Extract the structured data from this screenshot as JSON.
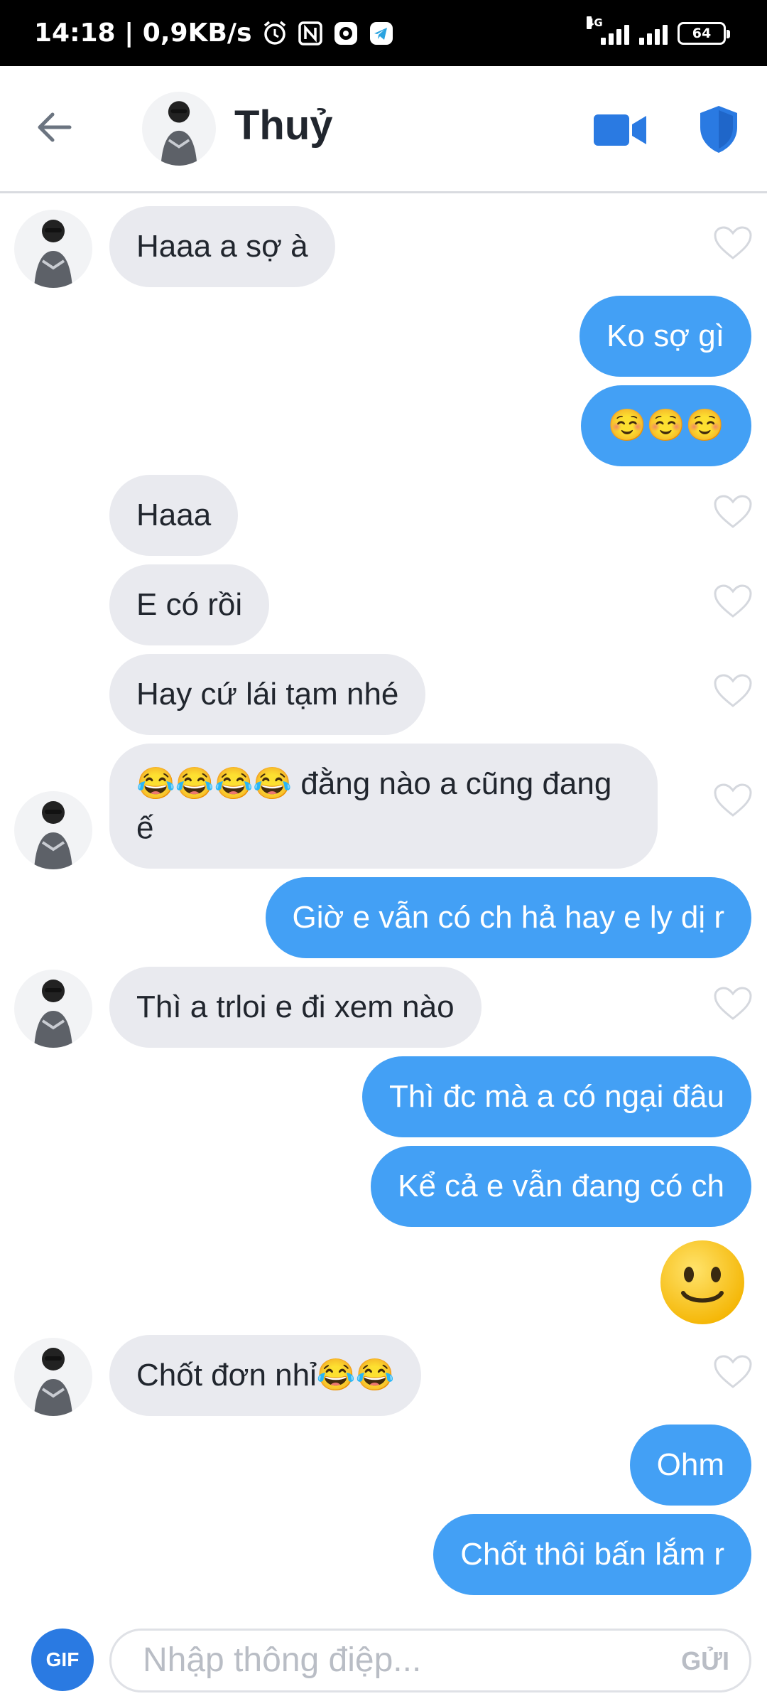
{
  "status_bar": {
    "time_speed": "14:18 | 0,9KB/s",
    "network": "4G",
    "battery": "64"
  },
  "header": {
    "contact_name": "Thuỷ"
  },
  "messages": [
    {
      "dir": "in",
      "text": "Haaa a sợ à"
    },
    {
      "dir": "out",
      "text": "Ko sợ gì"
    },
    {
      "dir": "out",
      "text": "☺️☺️☺️"
    },
    {
      "dir": "in",
      "text": "Haaa"
    },
    {
      "dir": "in",
      "text": "E có rồi"
    },
    {
      "dir": "in",
      "text": "Hay cứ lái tạm nhé"
    },
    {
      "dir": "in",
      "text": "😂😂😂😂 đằng nào a cũng đang ế"
    },
    {
      "dir": "out",
      "text": "Giờ e vẫn có ch hả hay e ly dị r"
    },
    {
      "dir": "in",
      "text": "Thì a trloi e đi xem nào"
    },
    {
      "dir": "out",
      "text": "Thì đc mà a có ngại đâu"
    },
    {
      "dir": "out",
      "text": "Kể cả e vẫn đang có ch"
    },
    {
      "dir": "out",
      "text": "",
      "emoji": "slightly-smiling-face"
    },
    {
      "dir": "in",
      "text": "Chốt đơn nhỉ😂😂"
    },
    {
      "dir": "out",
      "text": "Ohm"
    },
    {
      "dir": "out",
      "text": "Chốt thôi bấn lắm r"
    }
  ],
  "composer": {
    "gif_label": "GIF",
    "placeholder": "Nhập thông điệp...",
    "send_label": "GỬI"
  },
  "colors": {
    "outgoing_bubble": "#43a0f5",
    "incoming_bubble": "#e9eaef",
    "accent": "#2a7ae2"
  }
}
